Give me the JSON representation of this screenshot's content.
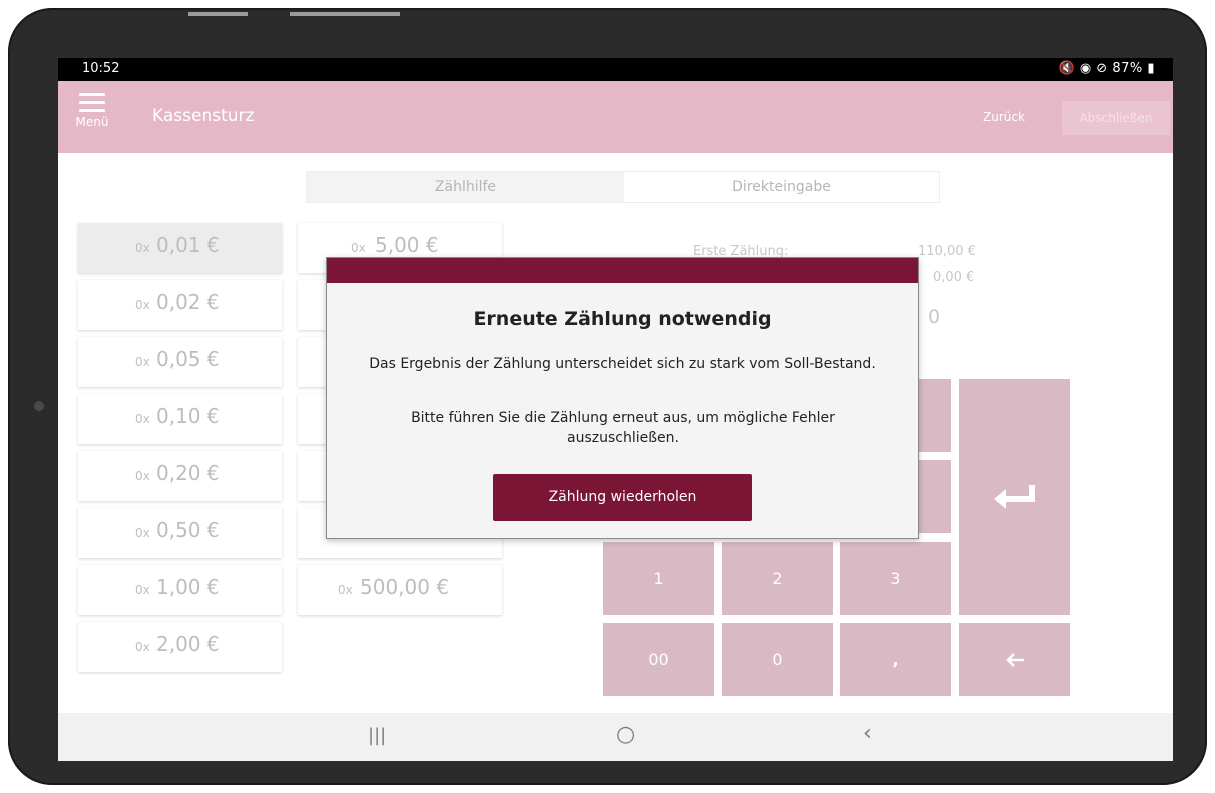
{
  "status_bar": {
    "time": "10:52",
    "system": "🔇 ◉ ⊘ 87% ▮"
  },
  "app_bar": {
    "menu_label": "Menü",
    "title": "Kassensturz",
    "back_label": "Zurück",
    "finish_label": "Abschließen"
  },
  "tabs": [
    {
      "label": "Zählhilfe",
      "active": true
    },
    {
      "label": "Direkteingabe",
      "active": false
    }
  ],
  "denominations_col1": [
    {
      "count": "0x",
      "value": "0,01 €"
    },
    {
      "count": "0x",
      "value": "0,02 €"
    },
    {
      "count": "0x",
      "value": "0,05 €"
    },
    {
      "count": "0x",
      "value": "0,10 €"
    },
    {
      "count": "0x",
      "value": "0,20 €"
    },
    {
      "count": "0x",
      "value": "0,50 €"
    },
    {
      "count": "0x",
      "value": "1,00 €"
    },
    {
      "count": "0x",
      "value": "2,00 €"
    }
  ],
  "denominations_col2": [
    {
      "count": "0x",
      "value": "5,00 €"
    },
    {
      "count": "0x",
      "value": "500,00 €"
    }
  ],
  "summary": {
    "first_count_label": "Erste Zählung:",
    "first_count_value": "110,00 €",
    "second_value": "0,00 €",
    "input_value": "0"
  },
  "keypad": {
    "one": "1",
    "two": "2",
    "three": "3",
    "double_zero": "00",
    "zero": "0",
    "comma": ",",
    "enter_icon": "enter-icon",
    "backspace_icon": "arrow-left-icon"
  },
  "dialog": {
    "title": "Erneute Zählung notwendig",
    "message1": "Das Ergebnis der Zählung unterscheidet sich zu stark vom Soll-Bestand.",
    "message2": "Bitte führen Sie die Zählung erneut aus, um mögliche Fehler auszuschließen.",
    "button": "Zählung wiederholen"
  },
  "nav_bar": {
    "recents": "|||",
    "home": "○",
    "back": "‹"
  },
  "colors": {
    "appbar": "#e4b8c6",
    "dialog_accent": "#7a1535",
    "keypad": "#d9b9c3"
  }
}
